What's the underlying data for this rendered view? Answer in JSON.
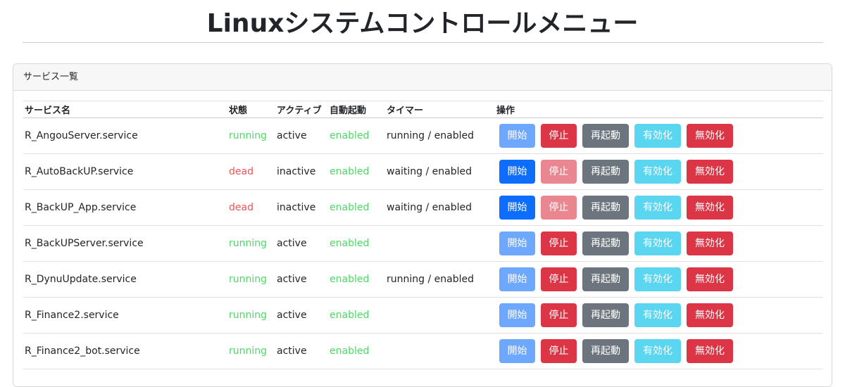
{
  "page": {
    "title": "Linuxシステムコントロールメニュー"
  },
  "card": {
    "header": "サービス一覧"
  },
  "table": {
    "headers": {
      "name": "サービス名",
      "state": "状態",
      "active": "アクティブ",
      "enabled": "自動起動",
      "timer": "タイマー",
      "actions": "操作"
    },
    "rows": [
      {
        "name": "R_AngouServer.service",
        "state": "running",
        "active": "active",
        "enabled": "enabled",
        "timer": "running / enabled",
        "start_disabled": true,
        "stop_disabled": false
      },
      {
        "name": "R_AutoBackUP.service",
        "state": "dead",
        "active": "inactive",
        "enabled": "enabled",
        "timer": "waiting / enabled",
        "start_disabled": false,
        "stop_disabled": true
      },
      {
        "name": "R_BackUP_App.service",
        "state": "dead",
        "active": "inactive",
        "enabled": "enabled",
        "timer": "waiting / enabled",
        "start_disabled": false,
        "stop_disabled": true
      },
      {
        "name": "R_BackUPServer.service",
        "state": "running",
        "active": "active",
        "enabled": "enabled",
        "timer": "",
        "start_disabled": true,
        "stop_disabled": false
      },
      {
        "name": "R_DynuUpdate.service",
        "state": "running",
        "active": "active",
        "enabled": "enabled",
        "timer": "running / enabled",
        "start_disabled": true,
        "stop_disabled": false
      },
      {
        "name": "R_Finance2.service",
        "state": "running",
        "active": "active",
        "enabled": "enabled",
        "timer": "",
        "start_disabled": true,
        "stop_disabled": false
      },
      {
        "name": "R_Finance2_bot.service",
        "state": "running",
        "active": "active",
        "enabled": "enabled",
        "timer": "",
        "start_disabled": true,
        "stop_disabled": false
      }
    ]
  },
  "buttons": {
    "start": "開始",
    "stop": "停止",
    "restart": "再起動",
    "enable": "有効化",
    "disable": "無効化"
  },
  "colors": {
    "running": "#4cd964",
    "dead": "#ec5555",
    "primary": "#0d6efd",
    "primary_disabled": "#6ea8fe",
    "danger": "#dc3545",
    "danger_disabled": "#ea868f",
    "secondary": "#6c757d",
    "info": "#5bd6f1"
  }
}
